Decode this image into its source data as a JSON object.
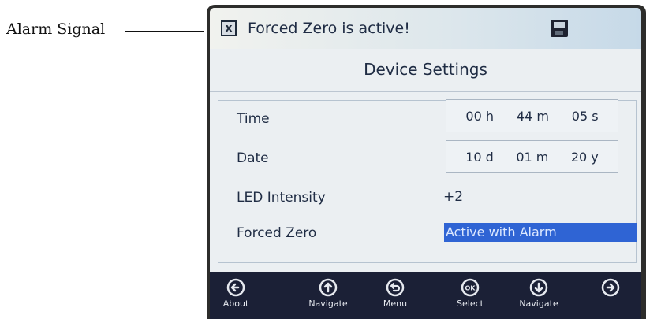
{
  "callout": {
    "label": "Alarm Signal"
  },
  "alarm": {
    "text": "Forced Zero is active!"
  },
  "title": "Device Settings",
  "settings": {
    "time": {
      "label": "Time",
      "hours": "00 h",
      "minutes": "44 m",
      "seconds": "05 s"
    },
    "date": {
      "label": "Date",
      "day": "10 d",
      "month": "01 m",
      "year": "20 y"
    },
    "led": {
      "label": "LED Intensity",
      "value": "+2"
    },
    "forced_zero": {
      "label": "Forced Zero",
      "value": "Active with Alarm"
    }
  },
  "softkeys": [
    {
      "label": "About",
      "icon": "arrow-left-circle-icon"
    },
    {
      "label": "Navigate",
      "icon": "arrow-up-circle-icon"
    },
    {
      "label": "Menu",
      "icon": "return-circle-icon"
    },
    {
      "label": "Select",
      "icon": "ok-circle-icon",
      "icon_text": "OK"
    },
    {
      "label": "Navigate",
      "icon": "arrow-down-circle-icon"
    },
    {
      "label": "",
      "icon": "arrow-right-circle-icon"
    }
  ],
  "colors": {
    "screen_background": "#ebeff2",
    "softkey_bar": "#1b2036",
    "selection_highlight": "#2f64d4",
    "text": "#1f2c44"
  }
}
